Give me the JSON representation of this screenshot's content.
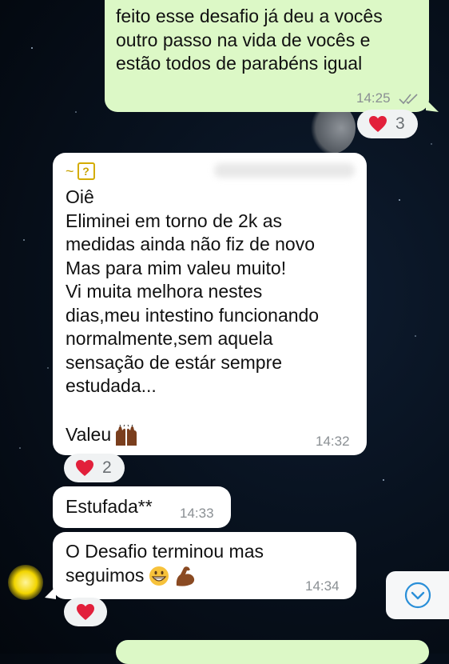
{
  "colors": {
    "outgoing_bubble": "#dcf8c6",
    "incoming_bubble": "#ffffff",
    "reaction_bg": "#f0f2f3",
    "time": "#8a8f93",
    "ticks": "#8a8f93",
    "heart": "#e2203b",
    "scroll_icon": "#2a8fd8"
  },
  "messages": [
    {
      "direction": "outgoing",
      "text": "feito esse desafio já deu a vocês\noutro passo na vida de vocês e\nestão todos de parabéns igual",
      "time": "14:25",
      "status_icon": "double-check-icon",
      "reaction": {
        "emoji": "heart-icon",
        "count": "3"
      }
    },
    {
      "direction": "incoming",
      "sender_prefix": "~",
      "sender_icon": "question-box-icon",
      "text": "Oiê\nEliminei em torno de 2k as\nmedidas ainda não fiz de novo\nMas para mim valeu muito!\nVi muita melhora nestes\ndias,meu intestino funcionando\nnormalmente,sem aquela\nsensação de estár sempre\nestudada...",
      "last_line": "Valeu",
      "last_line_emoji": "raised-hands-icon",
      "time": "14:32",
      "reaction": {
        "emoji": "heart-icon",
        "count": "2"
      }
    },
    {
      "direction": "incoming",
      "text": "Estufada**",
      "time": "14:33"
    },
    {
      "direction": "incoming",
      "text": "O Desafio terminou mas",
      "second_line": "seguimos",
      "emojis": [
        "grinning-face-icon",
        "flexed-biceps-icon"
      ],
      "time": "14:34",
      "reaction": {
        "emoji": "heart-icon",
        "count": ""
      }
    }
  ],
  "scroll_button": {
    "icon": "chevron-down-circle-icon"
  }
}
